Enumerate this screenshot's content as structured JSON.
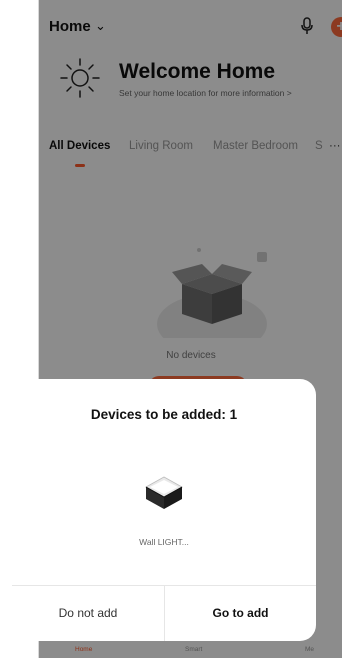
{
  "header": {
    "home_label": "Home",
    "mic_icon": "microphone-icon",
    "add_icon": "plus-icon",
    "add_glyph": "+"
  },
  "welcome": {
    "title": "Welcome Home",
    "subtitle": "Set your home location for more information  >"
  },
  "tabs": [
    {
      "label": "All Devices",
      "active": true
    },
    {
      "label": "Living Room",
      "active": false
    },
    {
      "label": "Master Bedroom",
      "active": false
    },
    {
      "label": "S",
      "active": false
    }
  ],
  "more_glyph": "···",
  "empty_state": {
    "text": "No devices"
  },
  "bottom_nav": [
    {
      "label": "Home",
      "active": true
    },
    {
      "label": "Smart",
      "active": false
    },
    {
      "label": "Me",
      "active": false
    }
  ],
  "modal": {
    "title": "Devices to be added: 1",
    "device_name": "Wall LIGHT...",
    "cancel_label": "Do not add",
    "confirm_label": "Go to add"
  },
  "colors": {
    "accent": "#ff5a2c",
    "overlay": "rgba(0,0,0,0.45)"
  }
}
